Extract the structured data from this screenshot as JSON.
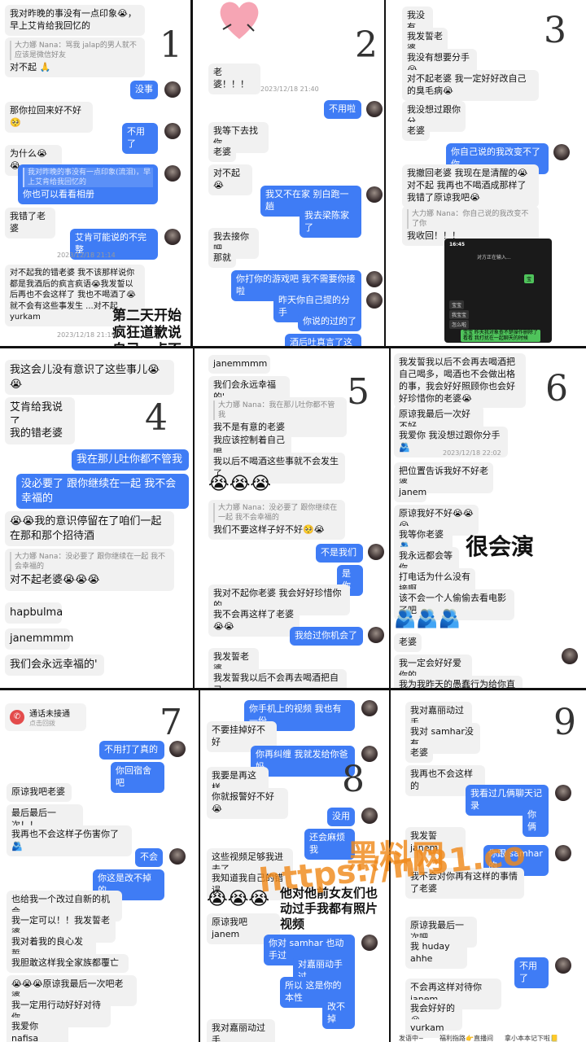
{
  "panel_numbers": [
    "1",
    "2",
    "3",
    "4",
    "5",
    "6",
    "7",
    "8",
    "9"
  ],
  "p1": {
    "m1": "我对昨晚的事没有一点印象😭，早上艾肯给我回忆的",
    "m2_quote": "大力娜 Nana：骂我 jalap的男人就不应该是微信好友",
    "m2": "对不起 🙏",
    "m3": "没事",
    "m4": "那你拉回来好不好🥺",
    "m5": "不用了",
    "m6": "为什么😭😭",
    "m7_quote": "我对昨晚的事没有一点印象(流泪)，早上艾肯给我回忆的",
    "m7": "你也可以看看相册",
    "m8": "我错了老婆",
    "m9": "艾肯可能说的不完整",
    "ts1": "2023/12/18 21:14",
    "m10": "对不起我的错老婆 我不该那样说你都是我酒后的疯言疯语😭我发誓以后再也不会这样了 我也不喝酒了😭就不会有这些事发生 ...对不起 yurkam",
    "ts2": "2023/12/18 21:19",
    "caption": "第二天开始疯狂道歉说自己一点不记得"
  },
  "p2": {
    "m1": "老婆！！！",
    "ts1": "2023/12/18 21:40",
    "m2": "不用啦",
    "m3": "我等下去找你",
    "m4": "老婆",
    "m5": "对不起😭",
    "m6": "我又不在家 别白跑一趟",
    "m7": "我去梁陈家了",
    "m8": "我去接你吧",
    "m9": "那就",
    "m10": "你打你的游戏吧 我不需要你接啦",
    "m11": "昨天你自己提的分手",
    "m12": "你说的过的了",
    "m13": "酒后吐真言了这是"
  },
  "p3": {
    "m1": "我没有",
    "m2": "我发誓老婆",
    "m3": "我没有想要分手😭",
    "m4": "对不起老婆 我一定好好改自己的臭毛病😭",
    "m5": "我没想过跟你分",
    "m6": "老婆",
    "m7": "你自己说的我改变不了你",
    "m8": "我撤回老婆 我现在是清醒的😭对不起 我再也不喝酒成那样了 我错了原谅我吧😭",
    "m9_quote": "大力娜 Nana：你自己说的我改变不了你",
    "m9": "我收回！！！",
    "phone_time": "16:45",
    "phone_title": "对方正在输入...",
    "phone_b1": "宝",
    "phone_b2": "宝宝",
    "phone_b3": "我宝宝",
    "phone_b4": "怎么啦",
    "phone_b5": "宝宝 昨天我对象查不楚操作删除了看看 我打扰在一起聊天的时候"
  },
  "p4": {
    "m1": "我这会儿没有意识了这些事儿😭😭",
    "m2": "艾肯给我说了",
    "m3": "我的错老婆",
    "m4": "我在那儿吐你都不管我",
    "m5": "没必要了 跟你继续在一起 我不会幸福的",
    "m6": "😭😭我的意识停留在了咱们一起在那和那个招待酒",
    "m7_quote": "大力娜 Nana：没必要了 跟你继续在一起 我不会幸福的",
    "m7": "对不起老婆😭😭😭",
    "m8": "hapbulma",
    "m9": "janemmmm",
    "m10": "我们会永远幸福的'"
  },
  "p5": {
    "m1": "janemmmm",
    "m2": "我们会永远幸福的'",
    "m3_quote": "大力娜 Nana：我在那儿吐你都不管我",
    "m3": "我不是有意的老婆",
    "m4": "我应该控制着自己喝",
    "m5": "我以后不喝酒这些事就不会发生了",
    "m6": "😭😭😭",
    "m7_quote": "大力娜 Nana：没必要了 跟你继续在一起 我不会幸福的",
    "m7": "我们不要这样子好不好🥺😭",
    "m8": "不是我们",
    "m9": "是你",
    "m10": "我对不起你老婆 我会好好珍惜你的",
    "m11": "我不会再这样了老婆😭😭",
    "m12": "我给过你机会了",
    "m13": "我发誓老婆",
    "m14": "我发誓我以后不会再去喝酒把自己"
  },
  "p6": {
    "m1": "我发誓我以后不会再去喝酒把自己喝多，喝酒也不会做出格的事，我会好好照顾你也会好好珍惜你的老婆😭",
    "m2": "原谅我最后一次好不好",
    "m3": "我爱你 我没想过跟你分手🫂",
    "ts1": "2023/12/18 22:02",
    "m4": "把位置告诉我好不好老婆",
    "m5": "janem",
    "m6": "原谅我好不好😭😭😭",
    "m7": "我等你老婆🫂",
    "m8": "我永远都会等你",
    "m9": "打电话为什么没有接啊",
    "m10": "该不会一个人偷偷去看电影了吧",
    "m11": "🫂🫂🫂",
    "m12": "老婆",
    "m13": "我一定会好好爱你的",
    "m14": "我为我昨天的愚蠢行为给你直诚的",
    "caption": "很会演"
  },
  "p7": {
    "call": "通话未接通",
    "call_sub": "点击回拨",
    "m1": "不用打了真的",
    "m2": "你回宿舍吧",
    "m3": "原谅我吧老婆",
    "m4": "最后最后一次！！",
    "m5": "我再也不会这样子伤害你了🫂",
    "m6": "不会",
    "m7": "你这是改不掉的",
    "m8": "也给我一个改过自新的机会",
    "m9": "我一定可以！！我发誓老婆",
    "m10": "我对着我的良心发誓",
    "m11": "我胆敢这样我全家族都覆亡",
    "m12": "😭😭😭原谅我最后一次吧老婆",
    "m13": "我一定用行动好好对待你",
    "m14": "我爱你 nafisa"
  },
  "p8": {
    "m1": "你手机上的视频 我也有一份",
    "m2": "不要挂掉好不好",
    "m3": "你再纠缠 我就发给你爸妈",
    "m4": "我要是再这样",
    "m5": "你就报警好不好😭",
    "m6": "没用",
    "m7": "还会麻烦我",
    "m8": "这些视频足够我进去了",
    "m9": "我知道我自己的错误",
    "m10": "😭😭😭",
    "m11": "原谅我吧 janem",
    "m12": "你对 samhar 也动手过",
    "m13": "对嘉丽动手过",
    "m14": "所以 这是你的本性",
    "m15": "改不掉",
    "m16": "我对嘉丽动过手",
    "caption": "他对他前女友们也动过手我都有照片视频"
  },
  "p9": {
    "m1": "我对嘉丽动过手",
    "m2": "我对 samhar没有",
    "m3": "老婆",
    "m4": "我再也不会这样的",
    "m5": "我看过几俩聊天记录",
    "m6": "你俩",
    "m7": "我发誓 janem",
    "m8": "你跟 samhar的",
    "m9": "我不会对你再有这样的事情了老婆",
    "m10": "原谅我最后一次吧",
    "m11": "我 huday ahhe",
    "m12": "不用了",
    "m13": "不会再这样对待你 janem",
    "m14": "我会好好的😭",
    "m15": "vurkam",
    "bar1": "发语中~",
    "bar2": "福利指路👉直播间",
    "bar3": "拿小本本记下啦📒"
  },
  "watermark": {
    "line1": "黑料网",
    "line2": "https://hl31.co"
  },
  "colors": {
    "sent_bubble": "#3f7cf5",
    "received_bubble": "#f1f1f1",
    "watermark": "#f08a1c"
  }
}
